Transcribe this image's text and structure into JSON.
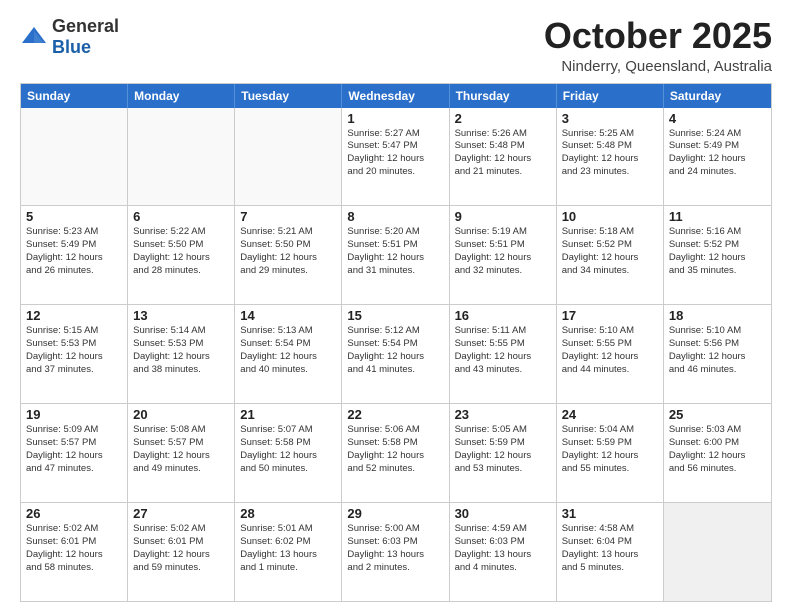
{
  "logo": {
    "general": "General",
    "blue": "Blue"
  },
  "title": "October 2025",
  "location": "Ninderry, Queensland, Australia",
  "header_days": [
    "Sunday",
    "Monday",
    "Tuesday",
    "Wednesday",
    "Thursday",
    "Friday",
    "Saturday"
  ],
  "rows": [
    [
      {
        "day": "",
        "text": ""
      },
      {
        "day": "",
        "text": ""
      },
      {
        "day": "",
        "text": ""
      },
      {
        "day": "1",
        "text": "Sunrise: 5:27 AM\nSunset: 5:47 PM\nDaylight: 12 hours\nand 20 minutes."
      },
      {
        "day": "2",
        "text": "Sunrise: 5:26 AM\nSunset: 5:48 PM\nDaylight: 12 hours\nand 21 minutes."
      },
      {
        "day": "3",
        "text": "Sunrise: 5:25 AM\nSunset: 5:48 PM\nDaylight: 12 hours\nand 23 minutes."
      },
      {
        "day": "4",
        "text": "Sunrise: 5:24 AM\nSunset: 5:49 PM\nDaylight: 12 hours\nand 24 minutes."
      }
    ],
    [
      {
        "day": "5",
        "text": "Sunrise: 5:23 AM\nSunset: 5:49 PM\nDaylight: 12 hours\nand 26 minutes."
      },
      {
        "day": "6",
        "text": "Sunrise: 5:22 AM\nSunset: 5:50 PM\nDaylight: 12 hours\nand 28 minutes."
      },
      {
        "day": "7",
        "text": "Sunrise: 5:21 AM\nSunset: 5:50 PM\nDaylight: 12 hours\nand 29 minutes."
      },
      {
        "day": "8",
        "text": "Sunrise: 5:20 AM\nSunset: 5:51 PM\nDaylight: 12 hours\nand 31 minutes."
      },
      {
        "day": "9",
        "text": "Sunrise: 5:19 AM\nSunset: 5:51 PM\nDaylight: 12 hours\nand 32 minutes."
      },
      {
        "day": "10",
        "text": "Sunrise: 5:18 AM\nSunset: 5:52 PM\nDaylight: 12 hours\nand 34 minutes."
      },
      {
        "day": "11",
        "text": "Sunrise: 5:16 AM\nSunset: 5:52 PM\nDaylight: 12 hours\nand 35 minutes."
      }
    ],
    [
      {
        "day": "12",
        "text": "Sunrise: 5:15 AM\nSunset: 5:53 PM\nDaylight: 12 hours\nand 37 minutes."
      },
      {
        "day": "13",
        "text": "Sunrise: 5:14 AM\nSunset: 5:53 PM\nDaylight: 12 hours\nand 38 minutes."
      },
      {
        "day": "14",
        "text": "Sunrise: 5:13 AM\nSunset: 5:54 PM\nDaylight: 12 hours\nand 40 minutes."
      },
      {
        "day": "15",
        "text": "Sunrise: 5:12 AM\nSunset: 5:54 PM\nDaylight: 12 hours\nand 41 minutes."
      },
      {
        "day": "16",
        "text": "Sunrise: 5:11 AM\nSunset: 5:55 PM\nDaylight: 12 hours\nand 43 minutes."
      },
      {
        "day": "17",
        "text": "Sunrise: 5:10 AM\nSunset: 5:55 PM\nDaylight: 12 hours\nand 44 minutes."
      },
      {
        "day": "18",
        "text": "Sunrise: 5:10 AM\nSunset: 5:56 PM\nDaylight: 12 hours\nand 46 minutes."
      }
    ],
    [
      {
        "day": "19",
        "text": "Sunrise: 5:09 AM\nSunset: 5:57 PM\nDaylight: 12 hours\nand 47 minutes."
      },
      {
        "day": "20",
        "text": "Sunrise: 5:08 AM\nSunset: 5:57 PM\nDaylight: 12 hours\nand 49 minutes."
      },
      {
        "day": "21",
        "text": "Sunrise: 5:07 AM\nSunset: 5:58 PM\nDaylight: 12 hours\nand 50 minutes."
      },
      {
        "day": "22",
        "text": "Sunrise: 5:06 AM\nSunset: 5:58 PM\nDaylight: 12 hours\nand 52 minutes."
      },
      {
        "day": "23",
        "text": "Sunrise: 5:05 AM\nSunset: 5:59 PM\nDaylight: 12 hours\nand 53 minutes."
      },
      {
        "day": "24",
        "text": "Sunrise: 5:04 AM\nSunset: 5:59 PM\nDaylight: 12 hours\nand 55 minutes."
      },
      {
        "day": "25",
        "text": "Sunrise: 5:03 AM\nSunset: 6:00 PM\nDaylight: 12 hours\nand 56 minutes."
      }
    ],
    [
      {
        "day": "26",
        "text": "Sunrise: 5:02 AM\nSunset: 6:01 PM\nDaylight: 12 hours\nand 58 minutes."
      },
      {
        "day": "27",
        "text": "Sunrise: 5:02 AM\nSunset: 6:01 PM\nDaylight: 12 hours\nand 59 minutes."
      },
      {
        "day": "28",
        "text": "Sunrise: 5:01 AM\nSunset: 6:02 PM\nDaylight: 13 hours\nand 1 minute."
      },
      {
        "day": "29",
        "text": "Sunrise: 5:00 AM\nSunset: 6:03 PM\nDaylight: 13 hours\nand 2 minutes."
      },
      {
        "day": "30",
        "text": "Sunrise: 4:59 AM\nSunset: 6:03 PM\nDaylight: 13 hours\nand 4 minutes."
      },
      {
        "day": "31",
        "text": "Sunrise: 4:58 AM\nSunset: 6:04 PM\nDaylight: 13 hours\nand 5 minutes."
      },
      {
        "day": "",
        "text": ""
      }
    ]
  ]
}
